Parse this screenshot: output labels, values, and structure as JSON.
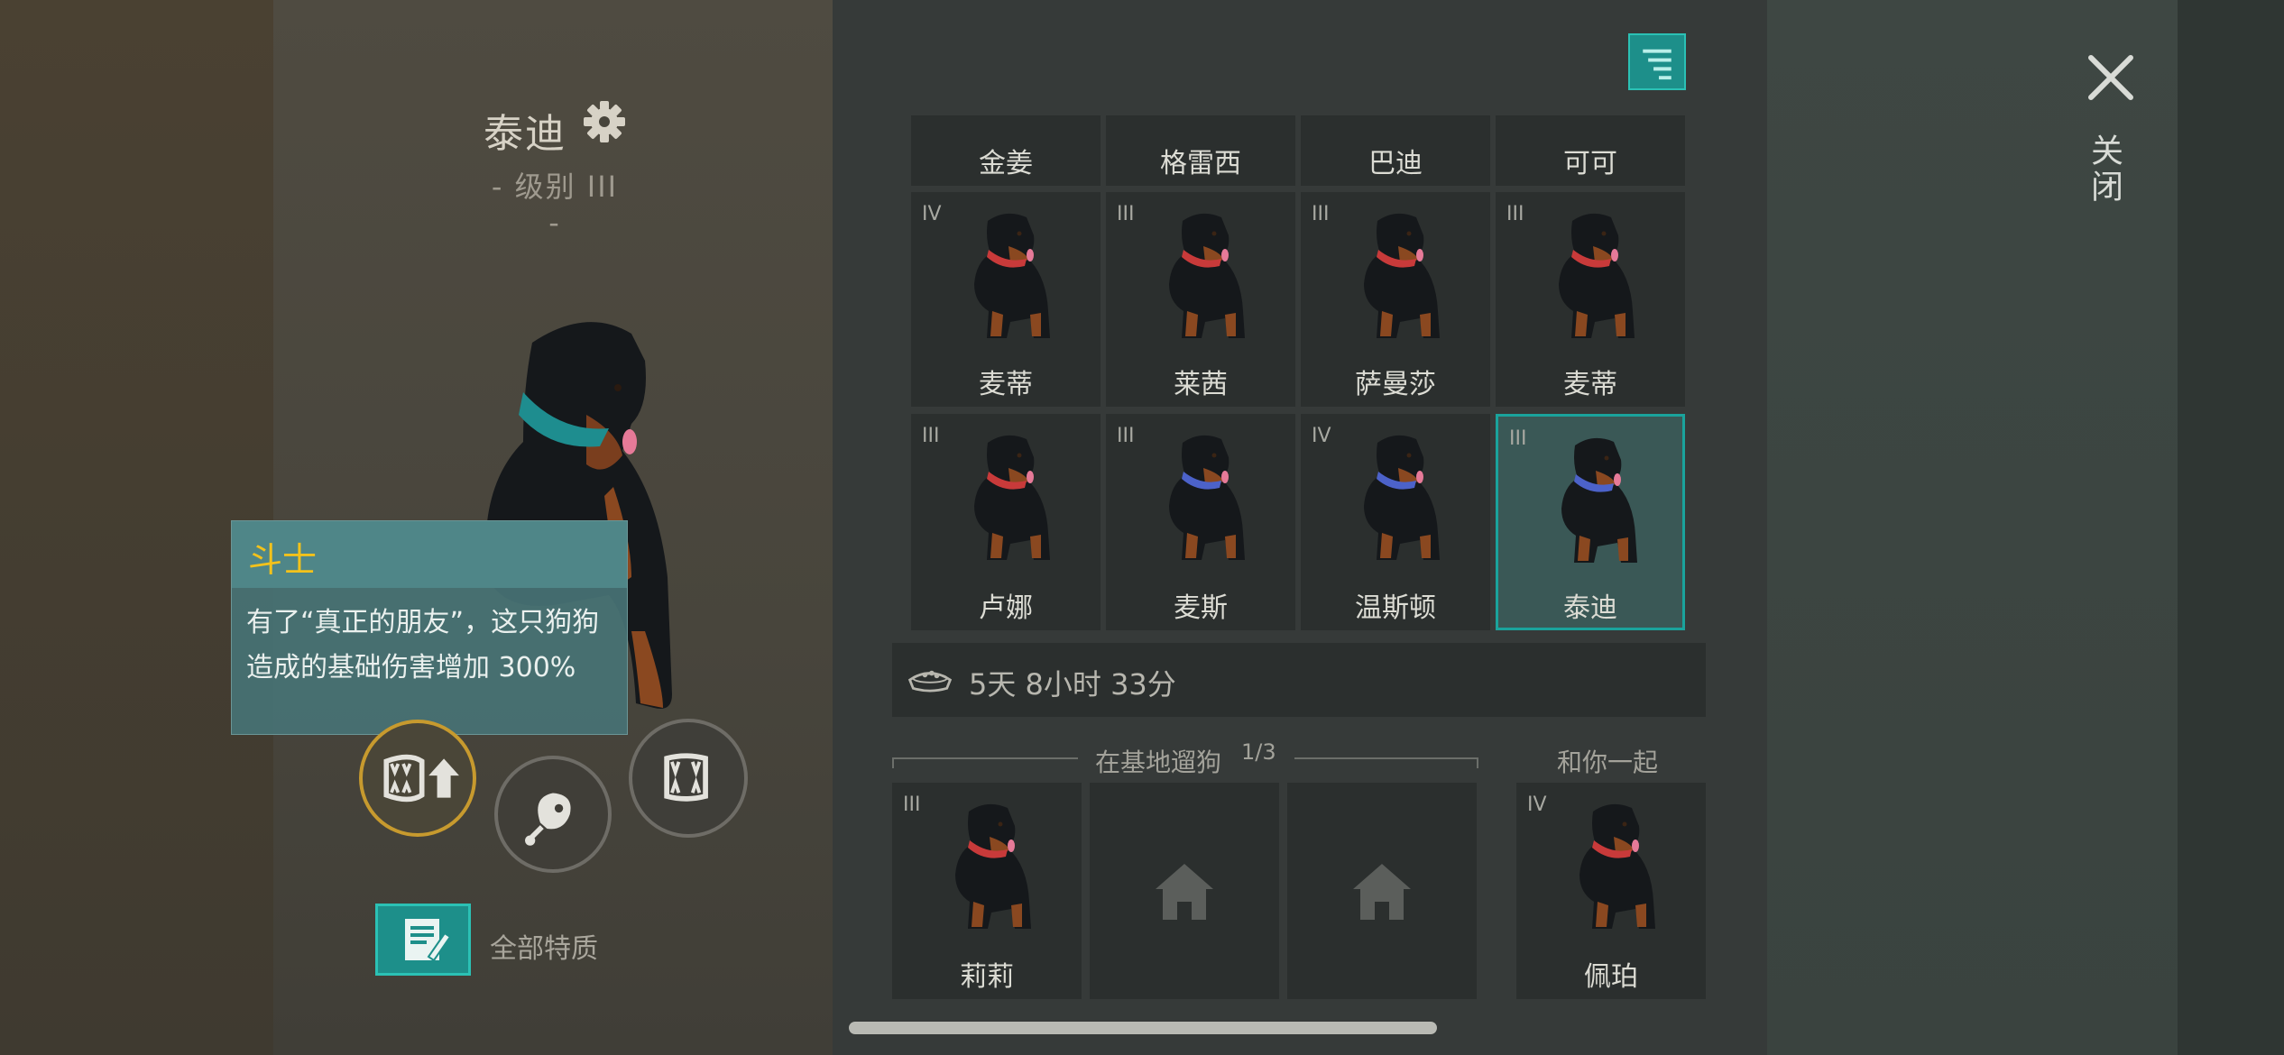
{
  "header": {
    "dog_name": "泰迪",
    "level": "- 级别 III -"
  },
  "tooltip": {
    "title": "斗士",
    "text": "有了“真正的朋友”，这只狗狗造成的基础伤害增加 300%"
  },
  "traits": {
    "label": "全部特质"
  },
  "top_row": [
    "金姜",
    "格雷西",
    "巴迪",
    "可可"
  ],
  "grid": [
    {
      "rank": "IV",
      "name": "麦蒂",
      "collar": "#c83a3a"
    },
    {
      "rank": "III",
      "name": "莱茜",
      "collar": "#c83a3a"
    },
    {
      "rank": "III",
      "name": "萨曼莎",
      "collar": "#c83a3a"
    },
    {
      "rank": "III",
      "name": "麦蒂",
      "collar": "#c83a3a"
    },
    {
      "rank": "III",
      "name": "卢娜",
      "collar": "#c83a3a"
    },
    {
      "rank": "III",
      "name": "麦斯",
      "collar": "#4c62c9"
    },
    {
      "rank": "IV",
      "name": "温斯顿",
      "collar": "#4c62c9"
    },
    {
      "rank": "III",
      "name": "泰迪",
      "collar": "#4c62c9",
      "selected": true
    }
  ],
  "feed": {
    "time": "5天 8小时 33分",
    "icon": "dog-bowl-icon"
  },
  "walk": {
    "label": "在基地遛狗",
    "count": "1/3",
    "slots": [
      {
        "rank": "III",
        "name": "莉莉",
        "collar": "#c83a3a"
      },
      {
        "empty": true,
        "icon": "home-icon"
      },
      {
        "empty": true,
        "icon": "home-icon"
      }
    ]
  },
  "companion": {
    "label": "和你一起",
    "rank": "IV",
    "name": "佩珀",
    "collar": "#c83a3a"
  },
  "close": {
    "label": "关闭"
  },
  "colors": {
    "accent": "#1d8f8a",
    "tooltip_title": "#f3c21b",
    "ability_selected": "#c79a2e"
  }
}
